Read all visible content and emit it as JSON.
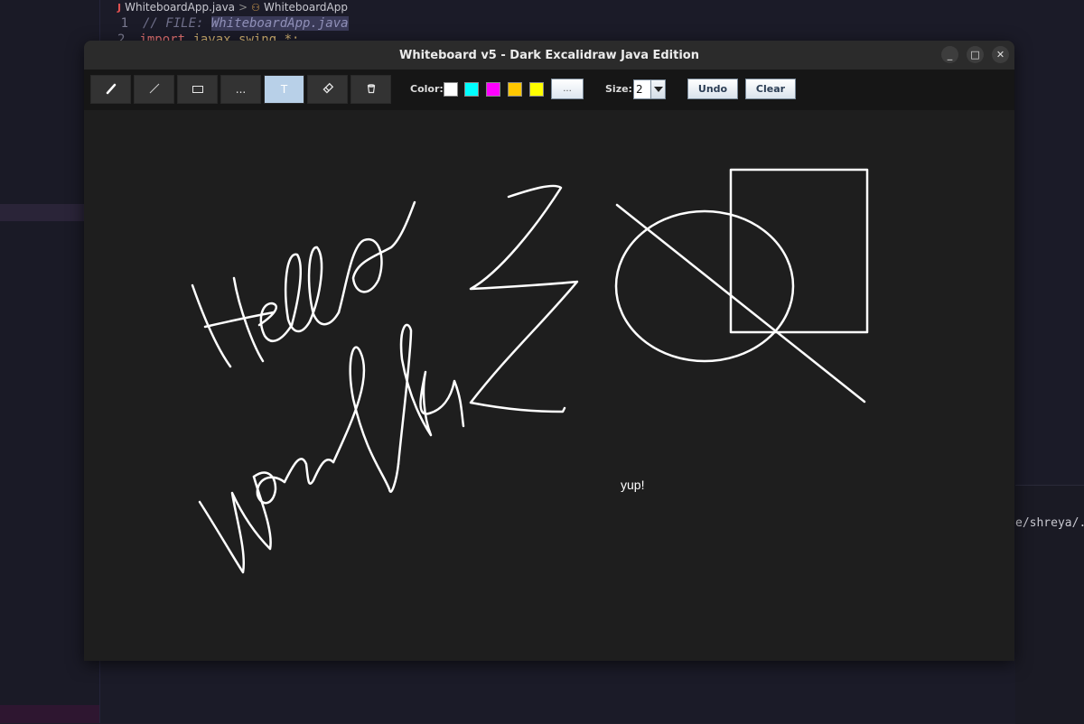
{
  "ide": {
    "tab_file": "WhiteboardApp.java",
    "tab_separator": ">",
    "tab_class": "WhiteboardApp",
    "line1_number": "1",
    "line1_prefix": "// FILE: ",
    "line1_file": "WhiteboardApp.java",
    "line2_number": "2",
    "line2_keyword": "import",
    "line2_package": "javax.swing.*;",
    "terminal_text": "e/shreya/.c"
  },
  "window": {
    "title": "Whiteboard v5 - Dark Excalidraw Java Edition",
    "controls": {
      "minimize": "_",
      "maximize": "□",
      "close": "✕"
    }
  },
  "toolbar": {
    "tools": [
      {
        "name": "pen",
        "icon": "pen-icon",
        "glyph": "✎",
        "active": false
      },
      {
        "name": "line",
        "icon": "line-icon",
        "glyph": "╱",
        "active": false
      },
      {
        "name": "rectangle",
        "icon": "rectangle-icon",
        "glyph": "▭",
        "active": false
      },
      {
        "name": "more",
        "icon": "more-icon",
        "glyph": "...",
        "active": false
      },
      {
        "name": "text",
        "icon": "text-icon",
        "glyph": "T",
        "active": true
      },
      {
        "name": "eraser",
        "icon": "eraser-icon",
        "glyph": "⌫",
        "active": false
      },
      {
        "name": "bucket",
        "icon": "bucket-icon",
        "glyph": "⛁",
        "active": false
      }
    ],
    "color_label": "Color:",
    "swatches": [
      "#ffffff",
      "#00ffff",
      "#ff00ff",
      "#ffc800",
      "#ffff00"
    ],
    "more_colors_label": "...",
    "size_label": "Size:",
    "size_value": "2",
    "undo_label": "Undo",
    "clear_label": "Clear"
  },
  "canvas": {
    "text_annotation": "yup!",
    "stroke_color": "#ffffff",
    "background": "#1e1e1e"
  }
}
